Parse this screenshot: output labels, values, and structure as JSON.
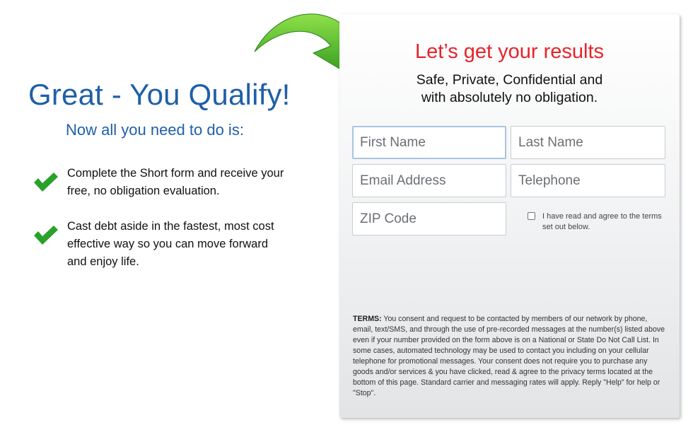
{
  "left": {
    "title": "Great - You Qualify!",
    "subtitle": "Now all you need to do is:",
    "bullets": [
      {
        "text": "Complete the Short form and receive your free, no obligation evaluation."
      },
      {
        "text": "Cast debt aside in the fastest, most cost effective way so you can move forward and enjoy life."
      }
    ]
  },
  "panel": {
    "title": "Let’s get your results",
    "subtitle_line1": "Safe, Private, Confidential and",
    "subtitle_line2": "with absolutely no obligation.",
    "fields": {
      "first_name": {
        "placeholder": "First Name",
        "value": ""
      },
      "last_name": {
        "placeholder": "Last Name",
        "value": ""
      },
      "email": {
        "placeholder": "Email Address",
        "value": ""
      },
      "telephone": {
        "placeholder": "Telephone",
        "value": ""
      },
      "zip": {
        "placeholder": "ZIP Code",
        "value": ""
      }
    },
    "agree_label": "I have read and agree to the terms set out below.",
    "terms_heading": "TERMS:",
    "terms_body": " You consent and request to be contacted by members of our network by phone, email, text/SMS, and through the use of pre-recorded messages at the number(s) listed above even if your number provided on the form above is on a National or State Do Not Call List. In some cases, automated technology may be used to contact you including on your cellular telephone for promotional messages. Your consent does not require you to purchase any goods and/or services & you have clicked, read & agree to the privacy terms located at the bottom of this page. Standard carrier and messaging rates will apply. Reply \"Help\" for help or \"Stop\"."
  },
  "colors": {
    "heading_blue": "#1f5fa8",
    "accent_red": "#e8232a",
    "check_green": "#2aa12a"
  },
  "icons": {
    "arrow": "curved-arrow-icon",
    "check": "check-icon"
  }
}
